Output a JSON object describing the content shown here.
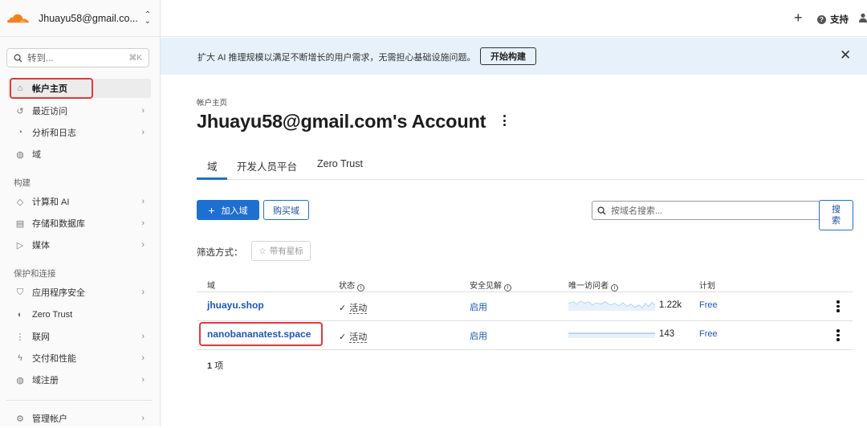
{
  "sidebar": {
    "account_name": "Jhuayu58@gmail.co...",
    "search": {
      "placeholder": "转到...",
      "shortcut": "⌘K"
    },
    "items": [
      {
        "label": "帐户主页",
        "icon": "home-icon",
        "active": true
      },
      {
        "label": "最近访问",
        "icon": "history-icon",
        "chevron": true
      },
      {
        "label": "分析和日志",
        "icon": "analytics-icon",
        "chevron": true
      },
      {
        "label": "域",
        "icon": "globe-icon"
      }
    ],
    "section_build": "构建",
    "build_items": [
      {
        "label": "计算和 AI",
        "icon": "compute-icon",
        "chevron": true
      },
      {
        "label": "存储和数据库",
        "icon": "database-icon",
        "chevron": true
      },
      {
        "label": "媒体",
        "icon": "media-icon",
        "chevron": true
      }
    ],
    "section_protect": "保护和连接",
    "protect_items": [
      {
        "label": "应用程序安全",
        "icon": "shield-icon",
        "chevron": true
      },
      {
        "label": "Zero Trust",
        "icon": "zero-trust-icon"
      },
      {
        "label": "联网",
        "icon": "network-icon",
        "chevron": true
      },
      {
        "label": "交付和性能",
        "icon": "bolt-icon",
        "chevron": true
      },
      {
        "label": "域注册",
        "icon": "globe-icon",
        "chevron": true
      }
    ],
    "bottom_item": {
      "label": "管理帐户",
      "icon": "gear-icon",
      "chevron": true
    }
  },
  "topbar": {
    "add_icon": "plus-icon",
    "support_label": "支持",
    "user_icon": "user-icon"
  },
  "banner": {
    "text": "扩大 AI 推理规模以满足不断增长的用户需求，无需担心基础设施问题。",
    "button": "开始构建"
  },
  "main": {
    "breadcrumb": "帐户主页",
    "title": "Jhuayu58@gmail.com's Account",
    "tabs": [
      "域",
      "开发人员平台",
      "Zero Trust"
    ],
    "add_domain_button": "加入域",
    "buy_domain_button": "购买域",
    "domain_search": {
      "placeholder": "按域名搜索...",
      "button": "搜\n索"
    },
    "filter_label": "筛选方式：",
    "star_filter": "带有星标",
    "table": {
      "headers": [
        "域",
        "状态",
        "安全见解",
        "唯一访问者",
        "计划"
      ],
      "rows": [
        {
          "domain": "jhuayu.shop",
          "status": "活动",
          "insight": "启用",
          "visitors": "1.22k",
          "plan": "Free"
        },
        {
          "domain": "nanobananatest.space",
          "status": "活动",
          "insight": "启用",
          "visitors": "143",
          "plan": "Free"
        }
      ]
    },
    "count_number": "1",
    "count_unit": "项"
  },
  "colors": {
    "accent_blue": "#1f6fd1",
    "link_blue": "#1f57b6",
    "banner_bg": "#e6f1fa",
    "highlight_red": "#e0393e",
    "cloudflare_orange": "#f38020"
  }
}
